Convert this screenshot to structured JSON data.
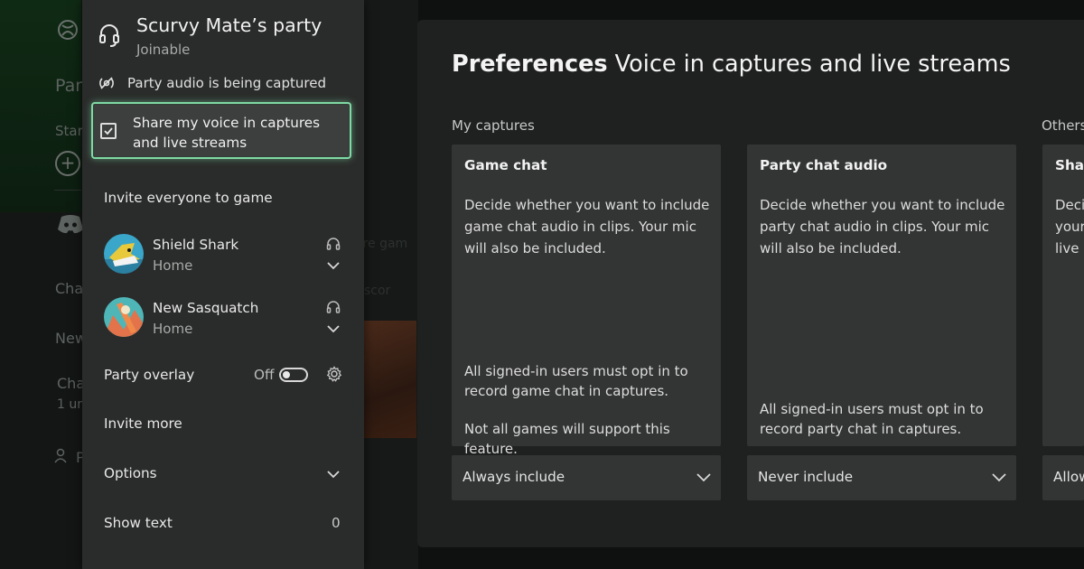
{
  "background": {
    "left_texts": [
      "Par",
      "Start",
      "Chat",
      "New",
      "Cha",
      "1 ur",
      "P"
    ],
    "ghost_texts": [
      "are gam",
      "scor"
    ]
  },
  "party": {
    "title": "Scurvy Mate’s party",
    "status": "Joinable",
    "capture_notice": "Party audio is being captured",
    "share_voice_label": "Share my voice in captures and live streams",
    "share_voice_checked": true,
    "invite_everyone": "Invite everyone to game",
    "members": [
      {
        "name": "Shield Shark",
        "location": "Home"
      },
      {
        "name": "New Sasquatch",
        "location": "Home"
      }
    ],
    "overlay": {
      "label": "Party overlay",
      "state": "Off"
    },
    "invite_more": "Invite more",
    "options": "Options",
    "show_text": {
      "label": "Show text",
      "count": "0"
    }
  },
  "preferences": {
    "title_bold": "Preferences",
    "title_rest": "Voice in captures and live streams",
    "my_captures_label": "My captures",
    "others_label": "Others",
    "cards": [
      {
        "title": "Game chat",
        "body": "Decide whether you want to include game chat audio in clips. Your mic will also be included.",
        "footer1": "All signed-in users must opt in to record game chat in captures.",
        "footer2": "Not all games will support this feature.",
        "select_value": "Always include"
      },
      {
        "title": "Party chat audio",
        "body": "Decide whether you want to include party chat audio in clips. Your mic will also be included.",
        "footer1": "All signed-in users must opt in to record party chat in captures.",
        "footer2": "",
        "select_value": "Never include"
      },
      {
        "title": "Shar",
        "body_lines": [
          "Deci",
          "your",
          "live s"
        ],
        "select_value": "Allow"
      }
    ]
  },
  "colors": {
    "focus_outline": "#7fd9a4",
    "panel": "#2a2c2b",
    "card": "#333534"
  }
}
